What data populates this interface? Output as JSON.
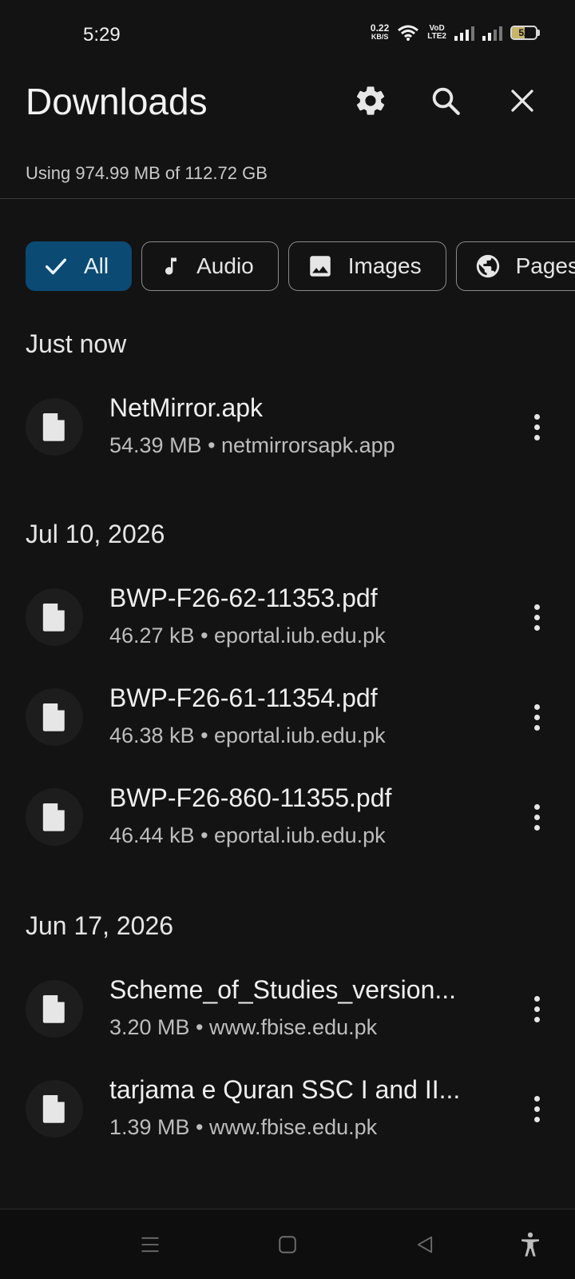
{
  "status_bar": {
    "time": "5:29",
    "net_speed_value": "0.22",
    "net_speed_unit": "KB/S",
    "volte_line1": "VoD",
    "volte_line2": "LTE2",
    "battery_level": "52",
    "battery_fraction": 0.52
  },
  "header": {
    "title": "Downloads",
    "storage_text": "Using 974.99 MB of 112.72 GB"
  },
  "filters": [
    {
      "label": "All",
      "icon": "check-icon",
      "selected": true
    },
    {
      "label": "Audio",
      "icon": "music-note-icon",
      "selected": false
    },
    {
      "label": "Images",
      "icon": "image-icon",
      "selected": false
    },
    {
      "label": "Pages",
      "icon": "globe-icon",
      "selected": false
    }
  ],
  "sections": [
    {
      "header": "Just now",
      "items": [
        {
          "name": "NetMirror.apk",
          "meta": "54.39 MB • netmirrorsapk.app"
        }
      ]
    },
    {
      "header": "Jul 10, 2026",
      "items": [
        {
          "name": "BWP-F26-62-11353.pdf",
          "meta": "46.27 kB • eportal.iub.edu.pk"
        },
        {
          "name": "BWP-F26-61-11354.pdf",
          "meta": "46.38 kB • eportal.iub.edu.pk"
        },
        {
          "name": "BWP-F26-860-11355.pdf",
          "meta": "46.44 kB • eportal.iub.edu.pk"
        }
      ]
    },
    {
      "header": "Jun 17, 2026",
      "items": [
        {
          "name": "Scheme_of_Studies_version...",
          "meta": "3.20 MB • www.fbise.edu.pk"
        },
        {
          "name": "tarjama e Quran SSC I and II...",
          "meta": "1.39 MB • www.fbise.edu.pk"
        }
      ]
    }
  ],
  "colors": {
    "background": "#131313",
    "selected_chip": "#0b4a73",
    "text_primary": "#efefef",
    "text_secondary": "#bdbdbd"
  }
}
